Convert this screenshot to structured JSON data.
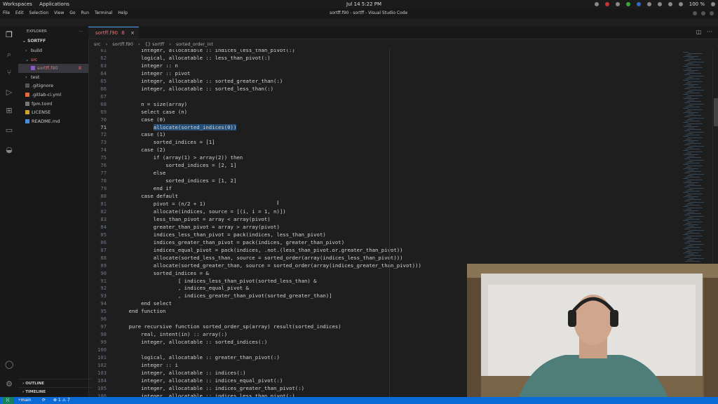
{
  "os": {
    "workspaces": "Workspaces",
    "applications": "Applications",
    "clock": "Jul 14  5:22 PM",
    "battery": "100 %"
  },
  "window": {
    "title": "sortff.f90 - sortff - Visual Studio Code",
    "menu": [
      "File",
      "Edit",
      "Selection",
      "View",
      "Go",
      "Run",
      "Terminal",
      "Help"
    ]
  },
  "sidebar": {
    "header": "EXPLORER",
    "project": "SORTFF",
    "items": [
      {
        "label": "build",
        "arrow": "›",
        "indent": 10
      },
      {
        "label": "src",
        "arrow": "⌄",
        "indent": 10
      },
      {
        "label": "sortff.f90",
        "arrow": "",
        "indent": 18,
        "badge": "8"
      },
      {
        "label": "test",
        "arrow": "›",
        "indent": 10
      },
      {
        "label": ".gitignore",
        "arrow": "",
        "indent": 10
      },
      {
        "label": ".gitlab-ci.yml",
        "arrow": "",
        "indent": 10
      },
      {
        "label": "fpm.toml",
        "arrow": "",
        "indent": 10
      },
      {
        "label": "LICENSE",
        "arrow": "",
        "indent": 10
      },
      {
        "label": "README.md",
        "arrow": "",
        "indent": 10
      }
    ],
    "outline": "OUTLINE",
    "timeline": "TIMELINE"
  },
  "tab": {
    "label": "sortff.f90",
    "badge": "8",
    "close": "×"
  },
  "breadcrumb": [
    "src",
    "›",
    "sortff.f90",
    "›",
    "{} sortff",
    "›",
    "sorted_order_int"
  ],
  "editor": {
    "current_line": 71,
    "lines": [
      {
        "n": "61",
        "t": "        integer, allocatable :: indices_less_than_pivot(:)"
      },
      {
        "n": "62",
        "t": "        logical, allocatable :: less_than_pivot(:)"
      },
      {
        "n": "63",
        "t": "        integer :: n"
      },
      {
        "n": "64",
        "t": "        integer :: pivot"
      },
      {
        "n": "65",
        "t": "        integer, allocatable :: sorted_greater_than(:)"
      },
      {
        "n": "66",
        "t": "        integer, allocatable :: sorted_less_than(:)"
      },
      {
        "n": "67",
        "t": ""
      },
      {
        "n": "68",
        "t": "        n = size(array)"
      },
      {
        "n": "69",
        "t": "        select case (n)"
      },
      {
        "n": "70",
        "t": "        case (0)"
      },
      {
        "n": "71",
        "t": "            allocate(sorted_indices(0))"
      },
      {
        "n": "72",
        "t": "        case (1)"
      },
      {
        "n": "73",
        "t": "            sorted_indices = [1]"
      },
      {
        "n": "74",
        "t": "        case (2)"
      },
      {
        "n": "75",
        "t": "            if (array(1) > array(2)) then"
      },
      {
        "n": "76",
        "t": "                sorted_indices = [2, 1]"
      },
      {
        "n": "77",
        "t": "            else"
      },
      {
        "n": "78",
        "t": "                sorted_indices = [1, 2]"
      },
      {
        "n": "79",
        "t": "            end if"
      },
      {
        "n": "80",
        "t": "        case default"
      },
      {
        "n": "81",
        "t": "            pivot = (n/2 + 1)"
      },
      {
        "n": "82",
        "t": "            allocate(indices, source = [(i, i = 1, n)])"
      },
      {
        "n": "83",
        "t": "            less_than_pivot = array < array(pivot)"
      },
      {
        "n": "84",
        "t": "            greater_than_pivot = array > array(pivot)"
      },
      {
        "n": "85",
        "t": "            indices_less_than_pivot = pack(indices, less_than_pivot)"
      },
      {
        "n": "86",
        "t": "            indices_greater_than_pivot = pack(indices, greater_than_pivot)"
      },
      {
        "n": "87",
        "t": "            indices_equal_pivot = pack(indices, .not.(less_than_pivot.or.greater_than_pivot))"
      },
      {
        "n": "88",
        "t": "            allocate(sorted_less_than, source = sorted_order(array(indices_less_than_pivot)))"
      },
      {
        "n": "89",
        "t": "            allocate(sorted_greater_than, source = sorted_order(array(indices_greater_than_pivot)))"
      },
      {
        "n": "90",
        "t": "            sorted_indices = &"
      },
      {
        "n": "91",
        "t": "                    [ indices_less_than_pivot(sorted_less_than) &"
      },
      {
        "n": "92",
        "t": "                    , indices_equal_pivot &"
      },
      {
        "n": "93",
        "t": "                    , indices_greater_than_pivot(sorted_greater_than)]"
      },
      {
        "n": "94",
        "t": "        end select"
      },
      {
        "n": "95",
        "t": "    end function"
      },
      {
        "n": "96",
        "t": ""
      },
      {
        "n": "97",
        "t": "    pure recursive function sorted_order_sp(array) result(sorted_indices)"
      },
      {
        "n": "98",
        "t": "        real, intent(in) :: array(:)"
      },
      {
        "n": "99",
        "t": "        integer, allocatable :: sorted_indices(:)"
      },
      {
        "n": "100",
        "t": ""
      },
      {
        "n": "101",
        "t": "        logical, allocatable :: greater_than_pivot(:)"
      },
      {
        "n": "102",
        "t": "        integer :: i"
      },
      {
        "n": "103",
        "t": "        integer, allocatable :: indices(:)"
      },
      {
        "n": "104",
        "t": "        integer, allocatable :: indices_equal_pivot(:)"
      },
      {
        "n": "105",
        "t": "        integer, allocatable :: indices_greater_than_pivot(:)"
      },
      {
        "n": "106",
        "t": "        integer, allocatable :: indices_less_than_pivot(:)"
      }
    ]
  },
  "status": {
    "branch": "main",
    "sync": "⟳",
    "problems": "⊗ 1 ⚠ 7"
  },
  "colors": {
    "accent": "#0a6ad6",
    "editor_bg": "#1e1e1e",
    "selection": "#264f78",
    "keyword": "#569cd6",
    "error_badge": "#e36b6b"
  }
}
